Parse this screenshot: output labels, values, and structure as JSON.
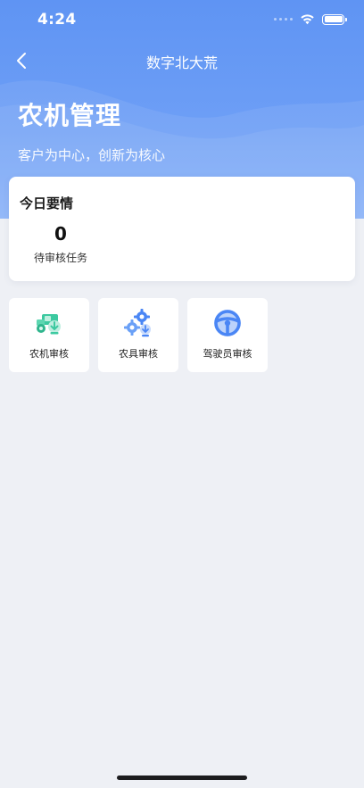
{
  "status_bar": {
    "time": "4:24",
    "icons": [
      "signal-icon",
      "wifi-icon",
      "battery-icon"
    ]
  },
  "nav": {
    "title": "数字北大荒",
    "back_icon": "chevron-left-icon"
  },
  "hero": {
    "title": "农机管理",
    "subtitle": "客户为中心，创新为核心"
  },
  "today": {
    "title": "今日要情",
    "stats": [
      {
        "value": "0",
        "label": "待审核任务"
      }
    ]
  },
  "tiles": [
    {
      "label": "农机审核",
      "icon": "tractor-icon",
      "color": "#3cc9a0"
    },
    {
      "label": "农具审核",
      "icon": "gears-icon",
      "color": "#4a86f5"
    },
    {
      "label": "驾驶员审核",
      "icon": "steering-wheel-icon",
      "color": "#4a86f5"
    }
  ],
  "colors": {
    "header_gradient_top": "#5f94f3",
    "header_gradient_bottom": "#83aef8",
    "background": "#eef0f5",
    "accent_blue": "#4a86f5",
    "accent_green": "#3cc9a0"
  }
}
